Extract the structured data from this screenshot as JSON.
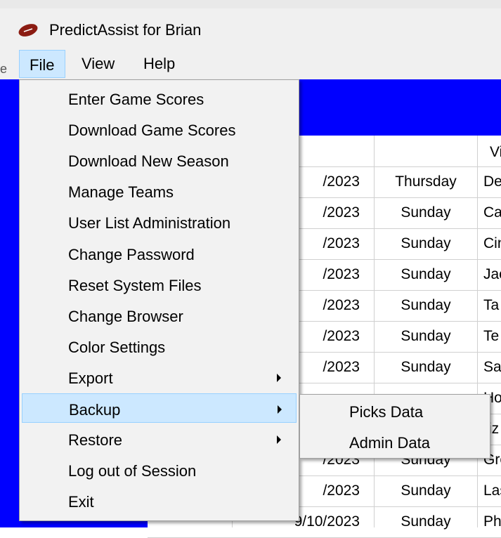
{
  "window": {
    "title": "PredictAssist for Brian",
    "icon": "football-icon"
  },
  "left_fragment": "e",
  "menubar": {
    "items": [
      "File",
      "View",
      "Help"
    ]
  },
  "file_menu": {
    "items": [
      "Enter Game Scores",
      "Download Game Scores",
      "Download New Season",
      "Manage Teams",
      "User List Administration",
      "Change Password",
      "Reset System Files",
      "Change Browser",
      "Color Settings",
      "Export",
      "Backup",
      "Restore",
      "Log out of Session",
      "Exit"
    ],
    "submenu_flags": [
      false,
      false,
      false,
      false,
      false,
      false,
      false,
      false,
      false,
      true,
      true,
      true,
      false,
      false
    ],
    "highlighted": "Backup"
  },
  "backup_submenu": {
    "items": [
      "Picks Data",
      "Admin Data"
    ]
  },
  "table": {
    "header_fragment": "Vi",
    "rows": [
      {
        "date": "/2023",
        "day": "Thursday",
        "team": "De"
      },
      {
        "date": "/2023",
        "day": "Sunday",
        "team": "Ca"
      },
      {
        "date": "/2023",
        "day": "Sunday",
        "team": "Cin"
      },
      {
        "date": "/2023",
        "day": "Sunday",
        "team": "Jac"
      },
      {
        "date": "/2023",
        "day": "Sunday",
        "team": "Ta"
      },
      {
        "date": "/2023",
        "day": "Sunday",
        "team": "Te"
      },
      {
        "date": "/2023",
        "day": "Sunday",
        "team": "Sa"
      },
      {
        "date": "",
        "day": "",
        "team": "Ho"
      },
      {
        "date": "",
        "day": "",
        "team": "riz"
      },
      {
        "date": "/2023",
        "day": "Sunday",
        "team": "Gre"
      },
      {
        "date": "/2023",
        "day": "Sunday",
        "team": "Las"
      },
      {
        "date": "9/10/2023",
        "day": "Sunday",
        "team": "Ph"
      }
    ]
  },
  "colors": {
    "accent_blue": "#0000ff",
    "highlight": "#cce8ff",
    "highlight_border": "#99d1ff"
  }
}
